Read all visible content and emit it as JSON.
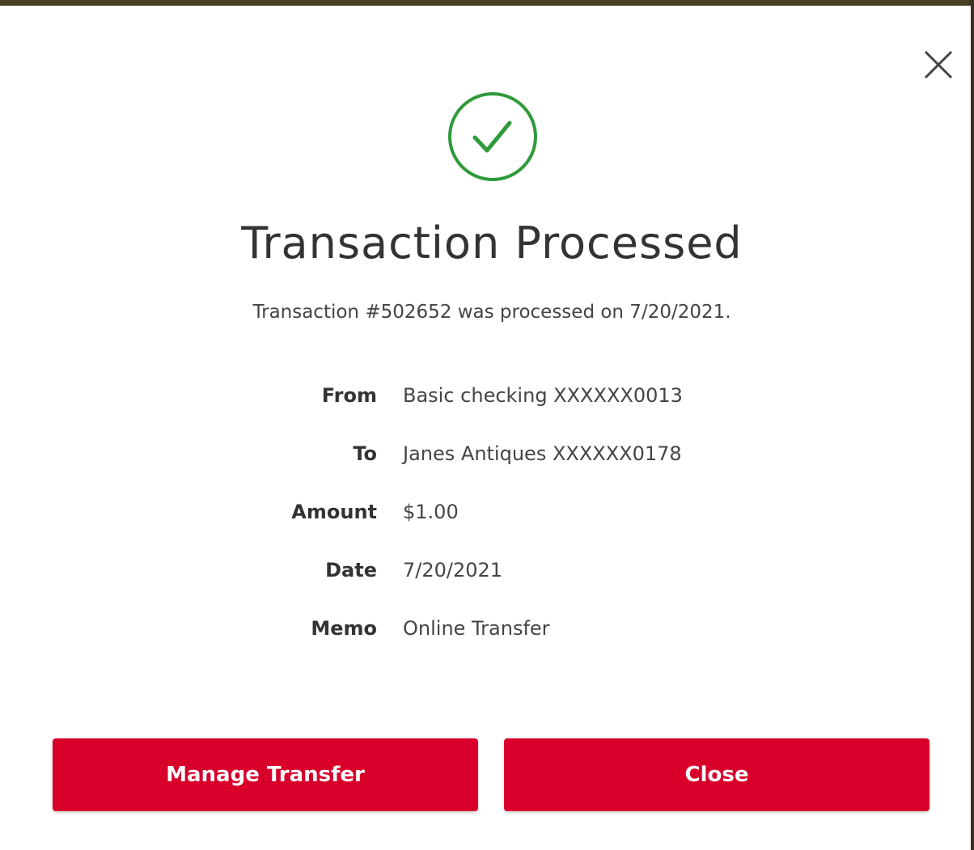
{
  "modal": {
    "title": "Transaction Processed",
    "subtitle": "Transaction #502652 was processed on 7/20/2021.",
    "icons": {
      "close": "close-icon",
      "status": "check-circle-icon"
    }
  },
  "details": [
    {
      "label": "From",
      "value": "Basic checking XXXXXX0013"
    },
    {
      "label": "To",
      "value": "Janes Antiques XXXXXX0178"
    },
    {
      "label": "Amount",
      "value": "$1.00"
    },
    {
      "label": "Date",
      "value": "7/20/2021"
    },
    {
      "label": "Memo",
      "value": "Online Transfer"
    }
  ],
  "buttons": {
    "manage_label": "Manage Transfer",
    "close_label": "Close"
  },
  "colors": {
    "accent": "#d8002a",
    "success": "#2e9a3a",
    "text": "#333333"
  }
}
